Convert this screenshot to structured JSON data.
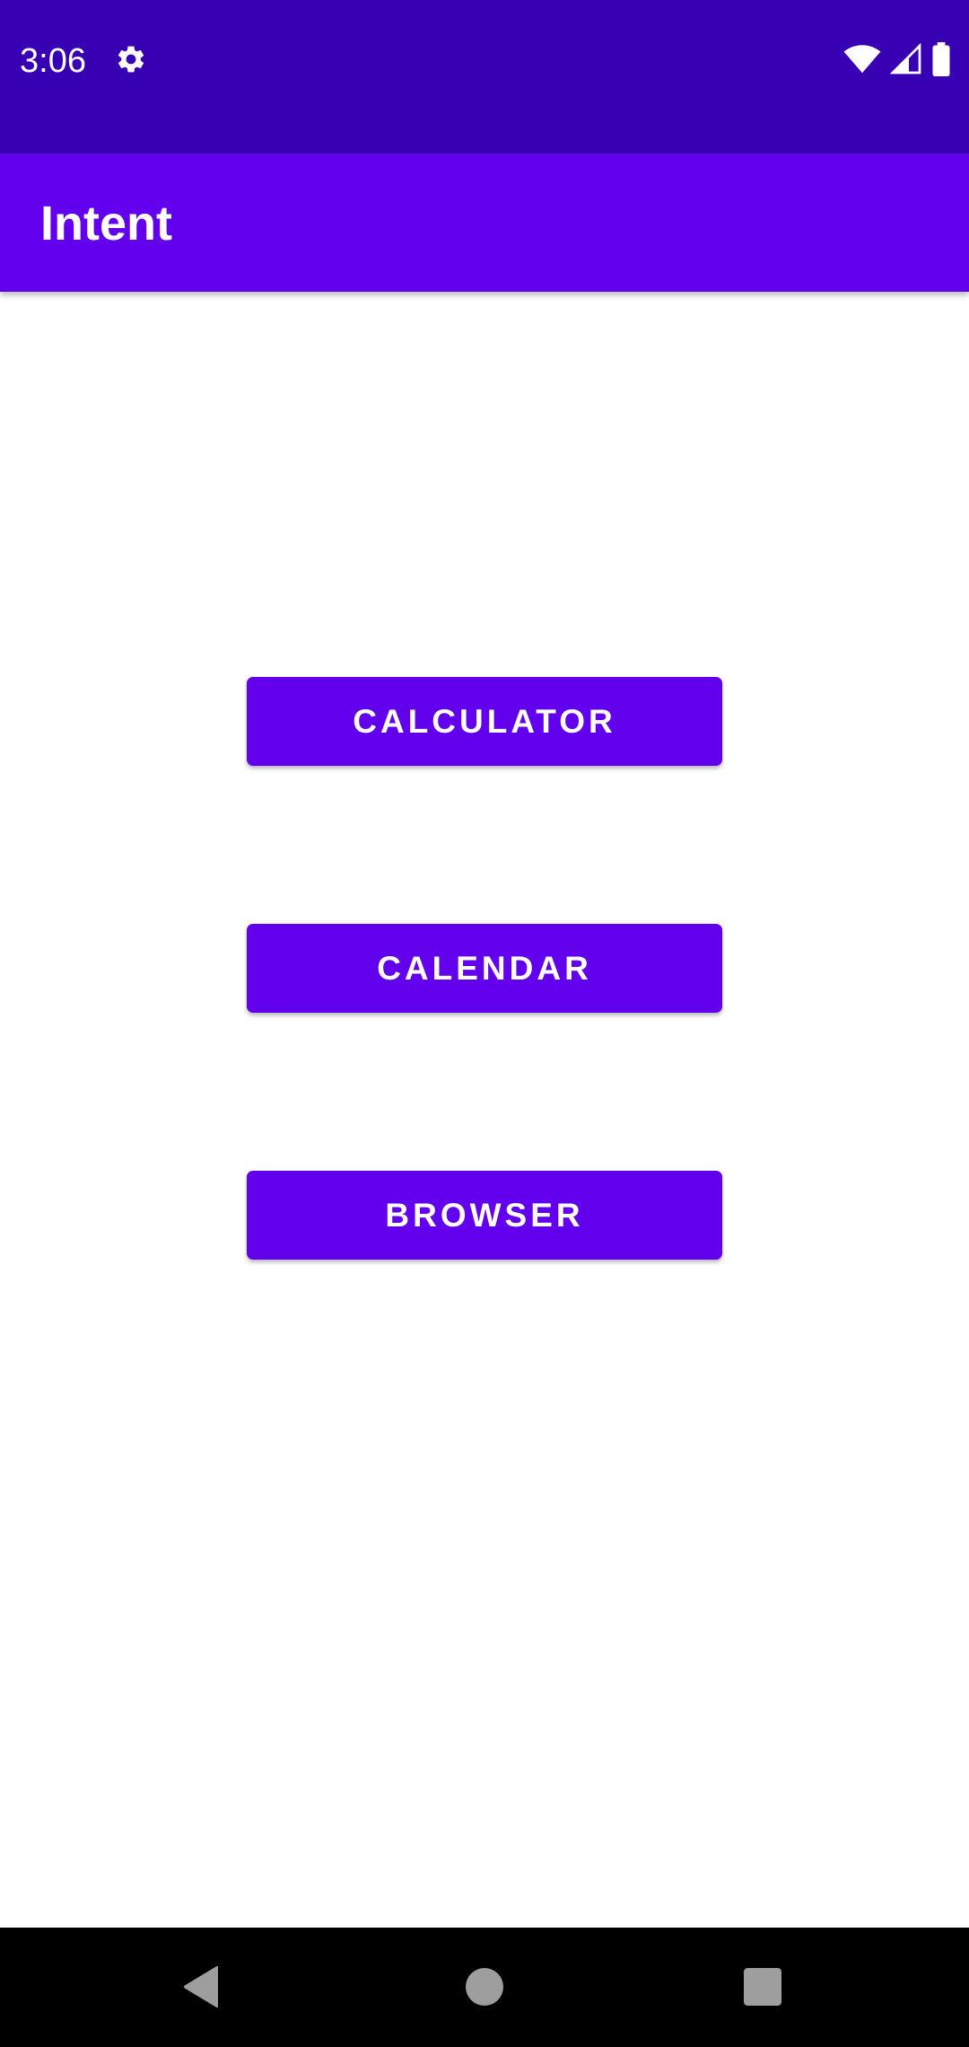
{
  "status_bar": {
    "time": "3:06",
    "icons": [
      "gear-icon",
      "wifi-icon",
      "signal-icon",
      "battery-icon"
    ]
  },
  "app_bar": {
    "title": "Intent"
  },
  "buttons": {
    "calculator": "CALCULATOR",
    "calendar": "CALENDAR",
    "browser": "BROWSER"
  },
  "nav_bar": {
    "icons": [
      "back-icon",
      "home-icon",
      "recents-icon"
    ]
  },
  "colors": {
    "status_bar": "#3700b3",
    "primary": "#6200ee",
    "background": "#ffffff",
    "nav_bar": "#000000"
  }
}
